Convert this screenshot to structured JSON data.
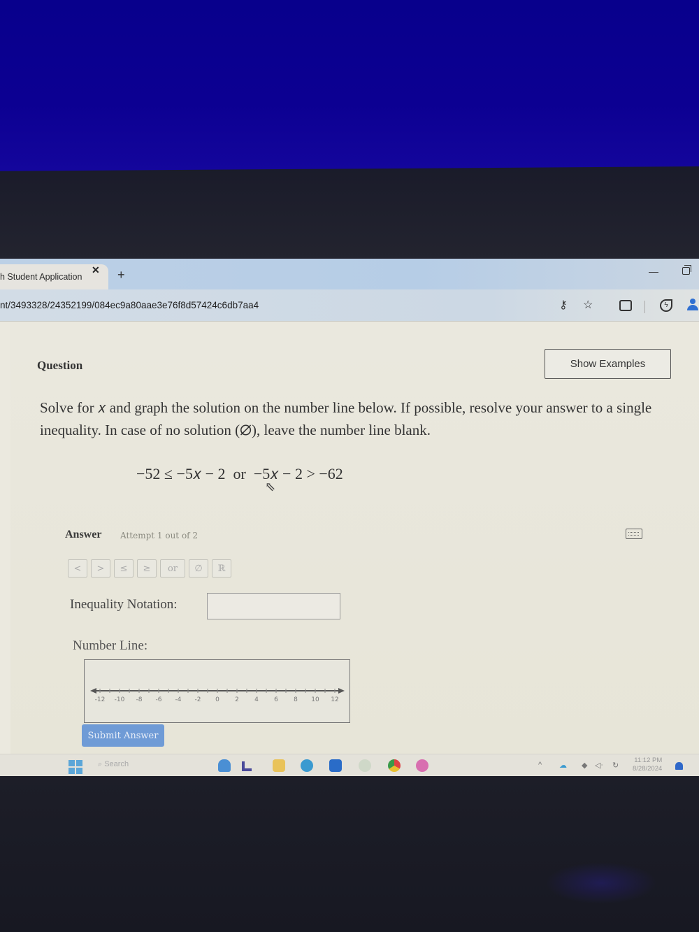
{
  "browser": {
    "tab_title": "h Student Application",
    "tab_close": "✕",
    "new_tab": "+",
    "url": "nt/3493328/24352199/084ec9a80aae3e76f8d57424c6db7aa4",
    "icons": [
      "password-key-icon",
      "favorite-star-icon",
      "extensions-icon",
      "copilot-icon",
      "profile-icon"
    ],
    "window_controls": {
      "minimize": "—"
    }
  },
  "question": {
    "label": "Question",
    "show_examples": "Show Examples",
    "prompt": "Solve for 𝑥 and graph the solution on the number line below. If possible, resolve your answer to a single inequality. In case of no solution (∅), leave the number line blank.",
    "equation": "−52 ≤ −5𝑥 − 2  or  −5𝑥 − 2 > −62"
  },
  "answer": {
    "label": "Answer",
    "attempt": "Attempt 1 out of 2",
    "symbols": [
      "<",
      ">",
      "≤",
      "≥",
      "or",
      "∅",
      "ℝ"
    ],
    "inequality_label": "Inequality Notation:",
    "inequality_value": "",
    "number_line_label": "Number Line:",
    "number_line": {
      "min": -13,
      "max": 13,
      "ticks": [
        -12,
        -10,
        -8,
        -6,
        -4,
        -2,
        0,
        2,
        4,
        6,
        8,
        10,
        12
      ],
      "minor_step": 1
    },
    "submit": "Submit Answer"
  },
  "taskbar": {
    "search": "Search",
    "time": "11:12 PM",
    "date": "8/28/2024"
  },
  "colors": {
    "submit_button": "#6f9bd6",
    "page_bg": "#eae8de",
    "wall_blue": "#0c0092"
  }
}
